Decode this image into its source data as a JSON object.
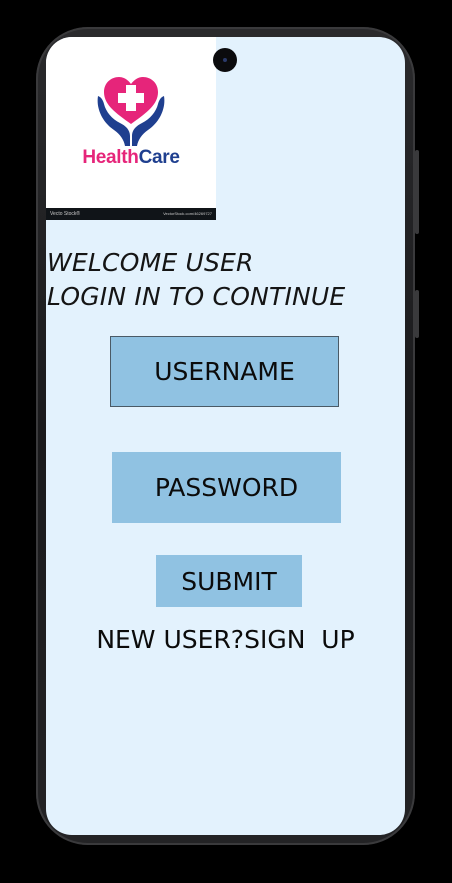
{
  "logo": {
    "brand_part1": "Health",
    "brand_part2": "Care",
    "stock_left": "Vecto Stock®",
    "stock_right": "VectorStock.com/46269727",
    "colors": {
      "heart": "#e6257a",
      "hands": "#1f3f8f",
      "cross": "#ffffff"
    }
  },
  "welcome": {
    "line1": "WELCOME USER",
    "line2": "LOGIN IN TO CONTINUE"
  },
  "form": {
    "username_label": "USERNAME",
    "password_label": "PASSWORD",
    "submit_label": "SUBMIT",
    "signup_text": "NEW USER?SIGN  UP"
  },
  "theme": {
    "screen_bg": "#e3f2fd",
    "field_bg": "#90c2e2"
  }
}
